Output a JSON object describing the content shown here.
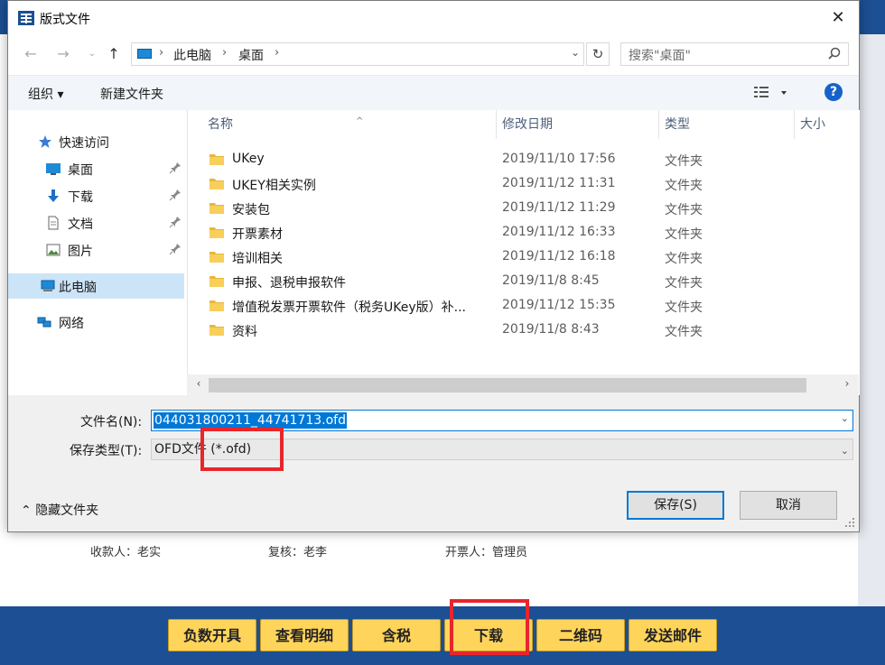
{
  "dialog": {
    "title": "版式文件",
    "close": "✕"
  },
  "address": {
    "crumbs": [
      "此电脑",
      "桌面"
    ],
    "search_placeholder": "搜索\"桌面\""
  },
  "toolbar": {
    "organize": "组织",
    "new_folder": "新建文件夹",
    "help": "?"
  },
  "nav": {
    "quick_access": "快速访问",
    "desktop": "桌面",
    "downloads": "下载",
    "documents": "文档",
    "pictures": "图片",
    "this_pc": "此电脑",
    "network": "网络"
  },
  "columns": {
    "name": "名称",
    "date": "修改日期",
    "type": "类型",
    "size": "大小"
  },
  "files": [
    {
      "name": "UKey",
      "date": "2019/11/10 17:56",
      "type": "文件夹"
    },
    {
      "name": "UKEY相关实例",
      "date": "2019/11/12 11:31",
      "type": "文件夹"
    },
    {
      "name": "安装包",
      "date": "2019/11/12 11:29",
      "type": "文件夹"
    },
    {
      "name": "开票素材",
      "date": "2019/11/12 16:33",
      "type": "文件夹"
    },
    {
      "name": "培训相关",
      "date": "2019/11/12 16:18",
      "type": "文件夹"
    },
    {
      "name": "申报、退税申报软件",
      "date": "2019/11/8 8:45",
      "type": "文件夹"
    },
    {
      "name": "增值税发票开票软件（税务UKey版）补...",
      "date": "2019/11/12 15:35",
      "type": "文件夹"
    },
    {
      "name": "资料",
      "date": "2019/11/8 8:43",
      "type": "文件夹"
    }
  ],
  "save_form": {
    "filename_label": "文件名(N):",
    "filename_value": "044031800211_44741713.ofd",
    "filetype_label": "保存类型(T):",
    "filetype_value": "OFD文件 (*.ofd)",
    "hide_folders": "隐藏文件夹",
    "save_button": "保存(S)",
    "cancel_button": "取消"
  },
  "background_app": {
    "payee": "收款人：老实",
    "reviewer": "复核：老李",
    "drawer": "开票人：管理员",
    "buttons": [
      "负数开具",
      "查看明细",
      "含税",
      "下载",
      "二维码",
      "发送邮件"
    ]
  },
  "colors": {
    "accent": "#0078d7",
    "app_bar": "#1c4f93",
    "app_button": "#ffd45a",
    "annotation": "#e8262b"
  }
}
